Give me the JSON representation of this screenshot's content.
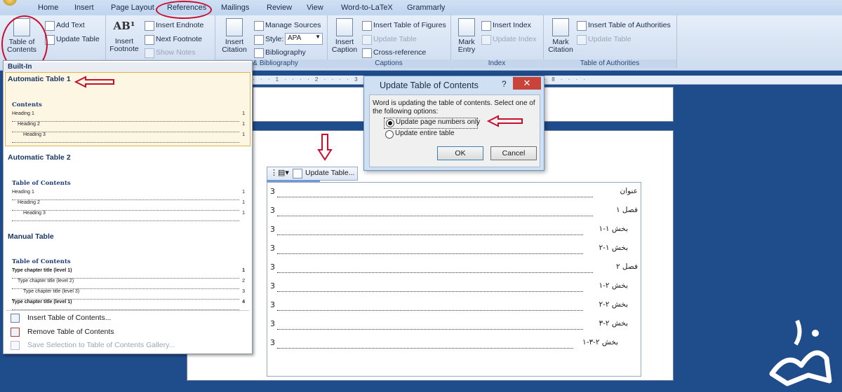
{
  "tabs": [
    "Home",
    "Insert",
    "Page Layout",
    "References",
    "Mailings",
    "Review",
    "View",
    "Word-to-LaTeX",
    "Grammarly"
  ],
  "ribbon": {
    "toc_label_1": "Table of",
    "toc_label_2": "Contents",
    "add_text": "Add Text",
    "update_table": "Update Table",
    "insert_footnote_1": "Insert",
    "insert_footnote_2": "Footnote",
    "insert_endnote": "Insert Endnote",
    "next_footnote": "Next Footnote",
    "show_notes": "Show Notes",
    "insert_citation_1": "Insert",
    "insert_citation_2": "Citation",
    "manage_sources": "Manage Sources",
    "style_label": "Style:",
    "style_value": "APA",
    "bibliography": "Bibliography",
    "citations_group": "ns & Bibliography",
    "insert_caption_1": "Insert",
    "insert_caption_2": "Caption",
    "insert_tof": "Insert Table of Figures",
    "update_table_cap": "Update Table",
    "cross_reference": "Cross-reference",
    "captions_group": "Captions",
    "mark_entry_1": "Mark",
    "mark_entry_2": "Entry",
    "insert_index": "Insert Index",
    "update_index": "Update Index",
    "index_group": "Index",
    "mark_citation_1": "Mark",
    "mark_citation_2": "Citation",
    "insert_toa": "Insert Table of Authorities",
    "update_table_toa": "Update Table",
    "toa_group": "Table of Authorities"
  },
  "dropdown": {
    "builtin": "Built-In",
    "auto1": {
      "header": "Automatic Table 1",
      "title": "Contents",
      "rows": [
        {
          "text": "Heading 1",
          "page": "1"
        },
        {
          "text": "Heading 2",
          "page": "1"
        },
        {
          "text": "Heading 3",
          "page": "1"
        }
      ]
    },
    "auto2": {
      "header": "Automatic Table 2",
      "title": "Table of Contents",
      "rows": [
        {
          "text": "Heading 1",
          "page": "1"
        },
        {
          "text": "Heading 2",
          "page": "1"
        },
        {
          "text": "Heading 3",
          "page": "1"
        }
      ]
    },
    "manual": {
      "header": "Manual Table",
      "title": "Table of Contents",
      "rows": [
        {
          "text": "Type chapter title (level 1)",
          "page": "1"
        },
        {
          "text": "Type chapter title (level 2)",
          "page": "2"
        },
        {
          "text": "Type chapter title (level 3)",
          "page": "3"
        },
        {
          "text": "Type chapter title (level 1)",
          "page": "4"
        }
      ]
    },
    "insert_toc": "Insert Table of Contents...",
    "remove_toc": "Remove Table of Contents",
    "save_selection": "Save Selection to Table of Contents Gallery..."
  },
  "dialog": {
    "title": "Update Table of Contents",
    "help": "?",
    "close": "✕",
    "message": "Word is updating the table of contents.  Select one of the following options:",
    "option1": "Update page numbers only",
    "option2": "Update entire table",
    "selected": "option1",
    "ok": "OK",
    "cancel": "Cancel"
  },
  "toc_toolbar": {
    "update_table": "Update Table..."
  },
  "toc": [
    {
      "text": "عنوان",
      "page": "3"
    },
    {
      "text": "فصل ۱",
      "page": "3"
    },
    {
      "text": "بخش ۱-۱",
      "page": "3"
    },
    {
      "text": "بخش ۱-۲",
      "page": "3"
    },
    {
      "text": "فصل ۲",
      "page": "3"
    },
    {
      "text": "بخش ۲-۱",
      "page": "3"
    },
    {
      "text": "بخش ۲-۲",
      "page": "3"
    },
    {
      "text": "بخش ۲-۳",
      "page": "3"
    },
    {
      "text": "بخش ۲-۳-۱",
      "page": "3"
    }
  ],
  "colors": {
    "annotation_red": "#c8102e",
    "ribbon_blue": "#cddcf0",
    "background": "#1f4c8a"
  }
}
